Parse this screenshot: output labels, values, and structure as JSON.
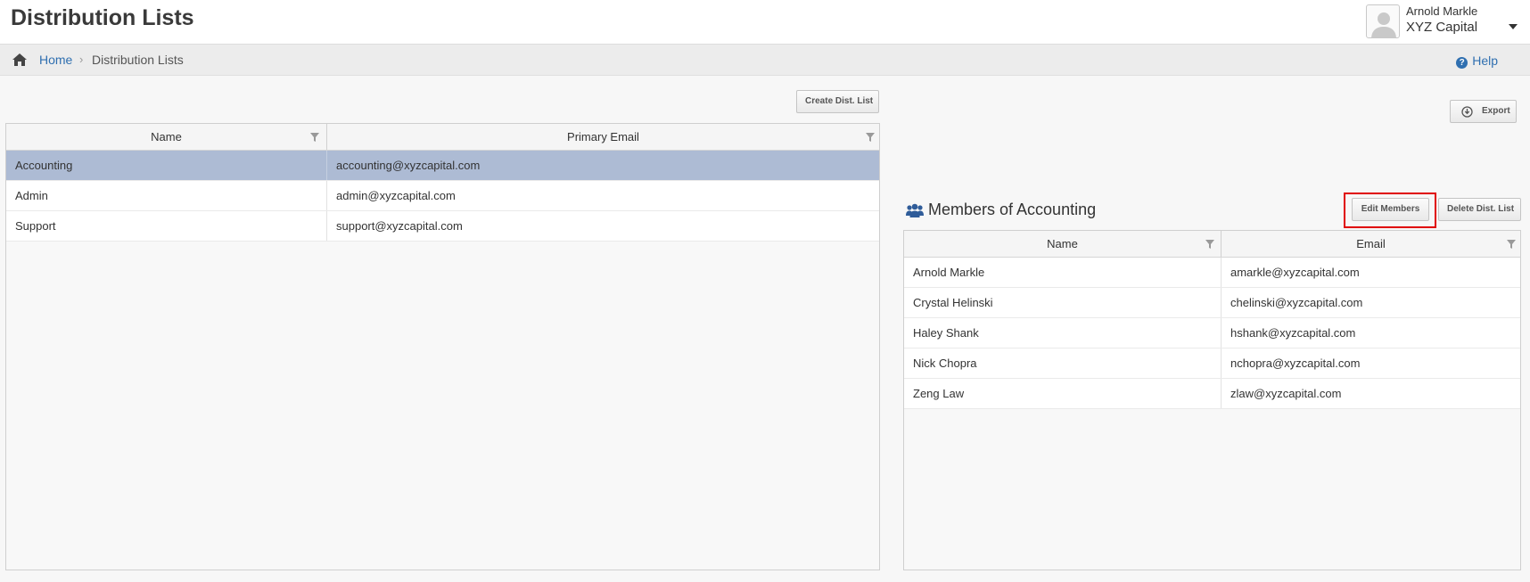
{
  "page": {
    "title": "Distribution Lists"
  },
  "user": {
    "name": "Arnold Markle",
    "company": "XYZ Capital"
  },
  "breadcrumb": {
    "home": "Home",
    "separator": "›",
    "current": "Distribution Lists"
  },
  "help": {
    "label": "Help",
    "icon_glyph": "?"
  },
  "buttons": {
    "create": "Create Dist. List",
    "export": "Export",
    "edit_members": "Edit Members",
    "delete": "Delete Dist. List"
  },
  "lists_table": {
    "columns": [
      "Name",
      "Primary Email"
    ],
    "rows": [
      {
        "name": "Accounting",
        "email": "accounting@xyzcapital.com",
        "selected": true
      },
      {
        "name": "Admin",
        "email": "admin@xyzcapital.com",
        "selected": false
      },
      {
        "name": "Support",
        "email": "support@xyzcapital.com",
        "selected": false
      }
    ]
  },
  "members": {
    "title": "Members of Accounting",
    "columns": [
      "Name",
      "Email"
    ],
    "rows": [
      {
        "name": "Arnold Markle",
        "email": "amarkle@xyzcapital.com"
      },
      {
        "name": "Crystal Helinski",
        "email": "chelinski@xyzcapital.com"
      },
      {
        "name": "Haley Shank",
        "email": "hshank@xyzcapital.com"
      },
      {
        "name": "Nick Chopra",
        "email": "nchopra@xyzcapital.com"
      },
      {
        "name": "Zeng Law",
        "email": "zlaw@xyzcapital.com"
      }
    ]
  },
  "colors": {
    "accent_blue": "#2f6fb0",
    "selected_row": "#adbbd4",
    "highlight_red": "#e00000"
  }
}
